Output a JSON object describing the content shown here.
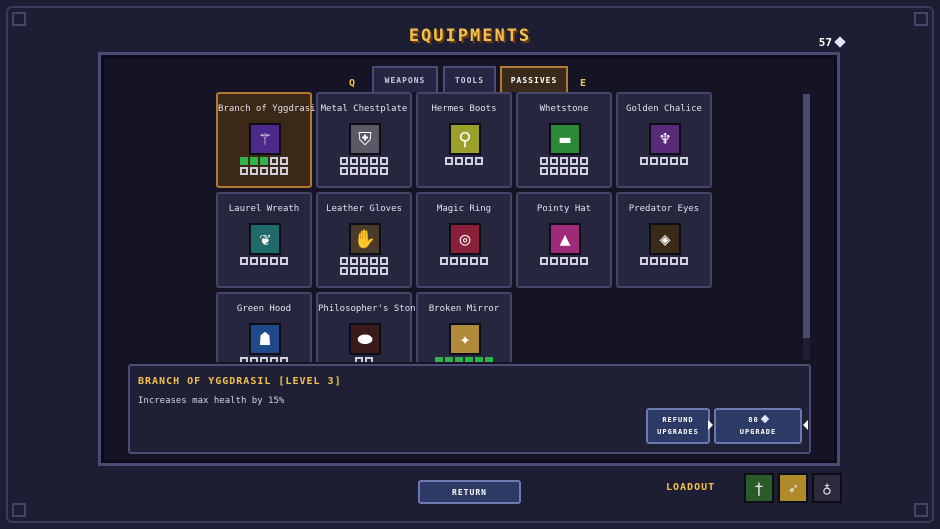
{
  "header": {
    "title": "EQUIPMENTS",
    "currency": "57"
  },
  "tabs": {
    "left_key": "Q",
    "right_key": "E",
    "items": [
      {
        "label": "WEAPONS",
        "active": false
      },
      {
        "label": "TOOLS",
        "active": false
      },
      {
        "label": "PASSIVES",
        "active": true
      }
    ]
  },
  "equipment": [
    {
      "name": "Branch of Yggdrasil",
      "icon": "branch-icon",
      "glyph": "⚚",
      "icon_color": "#4b2a8a",
      "levels": [
        5,
        5
      ],
      "filled": 3,
      "selected": true
    },
    {
      "name": "Metal Chestplate",
      "icon": "chestplate-icon",
      "glyph": "⛨",
      "icon_color": "#5a5a66",
      "levels": [
        5,
        5
      ],
      "filled": 0
    },
    {
      "name": "Hermes Boots",
      "icon": "boots-icon",
      "glyph": "⚲",
      "icon_color": "#9aa02a",
      "levels": [
        4
      ],
      "filled": 0
    },
    {
      "name": "Whetstone",
      "icon": "whetstone-icon",
      "glyph": "▬",
      "icon_color": "#2a8a3a",
      "levels": [
        5,
        5
      ],
      "filled": 0
    },
    {
      "name": "Golden Chalice",
      "icon": "chalice-icon",
      "glyph": "♆",
      "icon_color": "#5a2a7a",
      "levels": [
        5
      ],
      "filled": 0
    },
    {
      "name": "Laurel Wreath",
      "icon": "wreath-icon",
      "glyph": "❦",
      "icon_color": "#1f6a6a",
      "levels": [
        5
      ],
      "filled": 0
    },
    {
      "name": "Leather Gloves",
      "icon": "gloves-icon",
      "glyph": "✋",
      "icon_color": "#4a3a2a",
      "levels": [
        5,
        5
      ],
      "filled": 0
    },
    {
      "name": "Magic Ring",
      "icon": "ring-icon",
      "glyph": "◎",
      "icon_color": "#8a1f3a",
      "levels": [
        5
      ],
      "filled": 0
    },
    {
      "name": "Pointy Hat",
      "icon": "hat-icon",
      "glyph": "▲",
      "icon_color": "#a02a7a",
      "levels": [
        5
      ],
      "filled": 0
    },
    {
      "name": "Predator Eyes",
      "icon": "eyes-icon",
      "glyph": "◈",
      "icon_color": "#3a2a1a",
      "levels": [
        5
      ],
      "filled": 0
    },
    {
      "name": "Green Hood",
      "icon": "hood-icon",
      "glyph": "☗",
      "icon_color": "#1f4a8a",
      "levels": [
        5
      ],
      "filled": 0
    },
    {
      "name": "Philosopher's Stone",
      "icon": "stone-icon",
      "glyph": "⬬",
      "icon_color": "#3a1a1a",
      "levels": [
        2
      ],
      "filled": 0
    },
    {
      "name": "Broken Mirror",
      "icon": "mirror-icon",
      "glyph": "✦",
      "icon_color": "#b08a3a",
      "levels": [
        6
      ],
      "filled": 6
    }
  ],
  "description": {
    "title": "BRANCH OF YGGDRASIL [LEVEL 3]",
    "text": "Increases max health by 15%"
  },
  "actions": {
    "refund_line1": "REFUND",
    "refund_line2": "UPGRADES",
    "upgrade_cost": "80",
    "upgrade_label": "UPGRADE"
  },
  "footer": {
    "return_label": "RETURN",
    "loadout_label": "LOADOUT",
    "loadout": [
      {
        "icon": "sword-icon",
        "glyph": "†",
        "color": "#2a5a2a"
      },
      {
        "icon": "bow-icon",
        "glyph": "➶",
        "color": "#b08a2a"
      },
      {
        "icon": "potion-icon",
        "glyph": "♁",
        "color": "#2a2a3a"
      }
    ]
  },
  "colors": {
    "accent": "#f2c14e",
    "pip_filled": "#2fb34a",
    "selected_border": "#b5782e"
  }
}
